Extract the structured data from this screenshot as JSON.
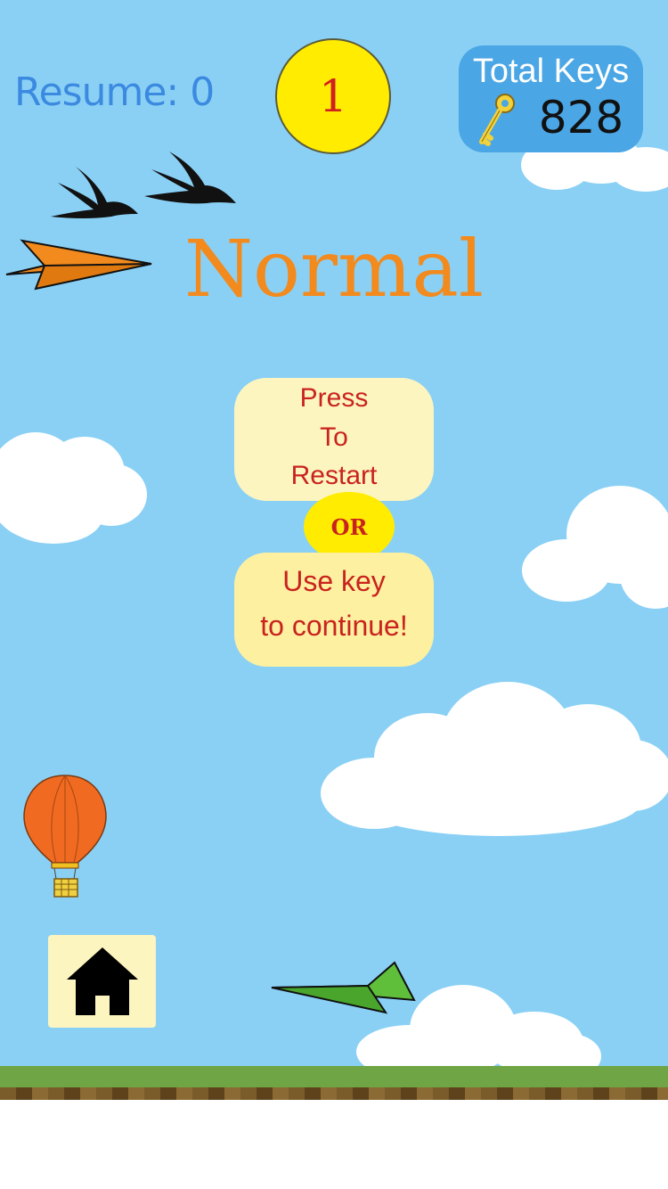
{
  "hud": {
    "resume_label": "Resume: 0",
    "level_number": "1",
    "total_keys_label": "Total Keys",
    "total_keys_count": "828"
  },
  "mode_label": "Normal",
  "restart_button": {
    "line1": "Press",
    "line2": "To",
    "line3": "Restart"
  },
  "or_label": "OR",
  "continue_button": {
    "line1": "Use key",
    "line2": "to continue!"
  },
  "icons": {
    "key": "key-icon",
    "home": "home-icon",
    "birds": "bird-silhouette-icon",
    "paper_plane_orange": "paper-plane-icon",
    "paper_plane_green": "paper-plane-icon",
    "balloon": "hot-air-balloon-icon"
  },
  "colors": {
    "sky": "#8ad0f5",
    "mode_text": "#f28a1d",
    "button_text": "#c9231f",
    "keys_box": "#4aa6e4",
    "level_circle": "#ffec00"
  }
}
